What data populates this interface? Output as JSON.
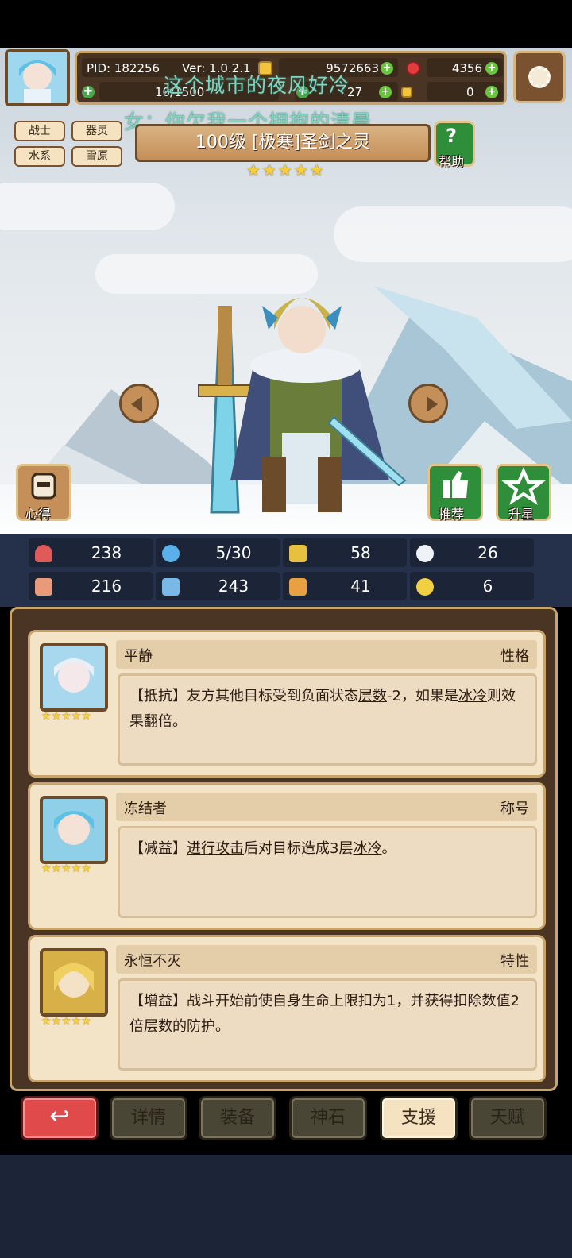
{
  "header": {
    "pid": "PID: 182256",
    "version": "Ver: 1.0.2.1",
    "gold": "9572663",
    "gems": "4356",
    "energy": "10/1500",
    "tickets": "27",
    "keys": "0"
  },
  "marquee": {
    "line1": "这个城市的夜风好冷",
    "line2": "女：你欠我一个拥抱的清晨"
  },
  "tags": [
    "战士",
    "器灵",
    "水系",
    "雪原"
  ],
  "hero": {
    "title": "100级 [极寒]圣剑之灵",
    "stars": 5
  },
  "buttons": {
    "help": "帮助",
    "notes": "心得",
    "recommend": "推荐",
    "star_up": "升星"
  },
  "stats": {
    "hp": "238",
    "mana": "5/30",
    "defense": "58",
    "speed": "26",
    "attack": "216",
    "magic": "243",
    "armor": "41",
    "crit": "6"
  },
  "cards": [
    {
      "name": "平静",
      "kind": "性格",
      "tag": "【抵抗】",
      "text_a": "友方其他目标受到负面状态",
      "u1": "层数",
      "text_b": "-2，如果是",
      "u2": "冰冷",
      "text_c": "则效果翻倍。"
    },
    {
      "name": "冻结者",
      "kind": "称号",
      "tag": "【减益】",
      "u1": "进行攻击",
      "text_a": "后对目标造成3层",
      "u2": "冰冷",
      "text_b": "。"
    },
    {
      "name": "永恒不灭",
      "kind": "特性",
      "tag": "【增益】",
      "text_a": "战斗开始前使自身生命上限扣为1，并获得扣除数值2倍",
      "u1": "层数",
      "text_b": "的",
      "u2": "防护",
      "text_c": "。"
    }
  ],
  "tabs": {
    "back": "↩",
    "details": "详情",
    "equipment": "装备",
    "divine_stone": "神石",
    "support": "支援",
    "talent": "天赋"
  },
  "colors": {
    "panel": "#4a3524",
    "card": "#f3e4c8",
    "active_tab": "#f4e2c0",
    "back_tab": "#e04a4a",
    "marquee": "#7ed6c0"
  }
}
